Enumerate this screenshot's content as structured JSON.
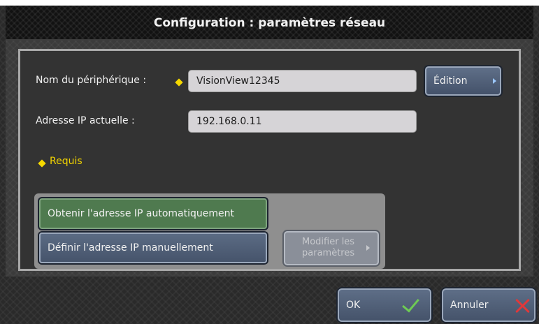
{
  "window": {
    "title": "Configuration : paramètres réseau"
  },
  "form": {
    "device_name_label": "Nom du périphérique :",
    "device_name_value": "VisionView12345",
    "edit_button_label": "Édition",
    "ip_label": "Adresse IP actuelle :",
    "ip_value": "192.168.0.11",
    "required_label": "Requis"
  },
  "ip_mode": {
    "auto_label": "Obtenir l'adresse IP automatiquement",
    "manual_label": "Définir l'adresse IP manuellement",
    "modify_label_line1": "Modifier les",
    "modify_label_line2": "paramètres",
    "selected": "auto"
  },
  "footer": {
    "ok_label": "OK",
    "cancel_label": "Annuler"
  },
  "icons": {
    "required": "diamond-icon",
    "chevron": "chevron-right-icon",
    "ok": "check-icon",
    "cancel": "close-icon"
  },
  "colors": {
    "required_marker": "#f5d800",
    "selected_option": "#4f7a4f",
    "ok_check": "#6ecb54",
    "cancel_x": "#e0383a"
  }
}
